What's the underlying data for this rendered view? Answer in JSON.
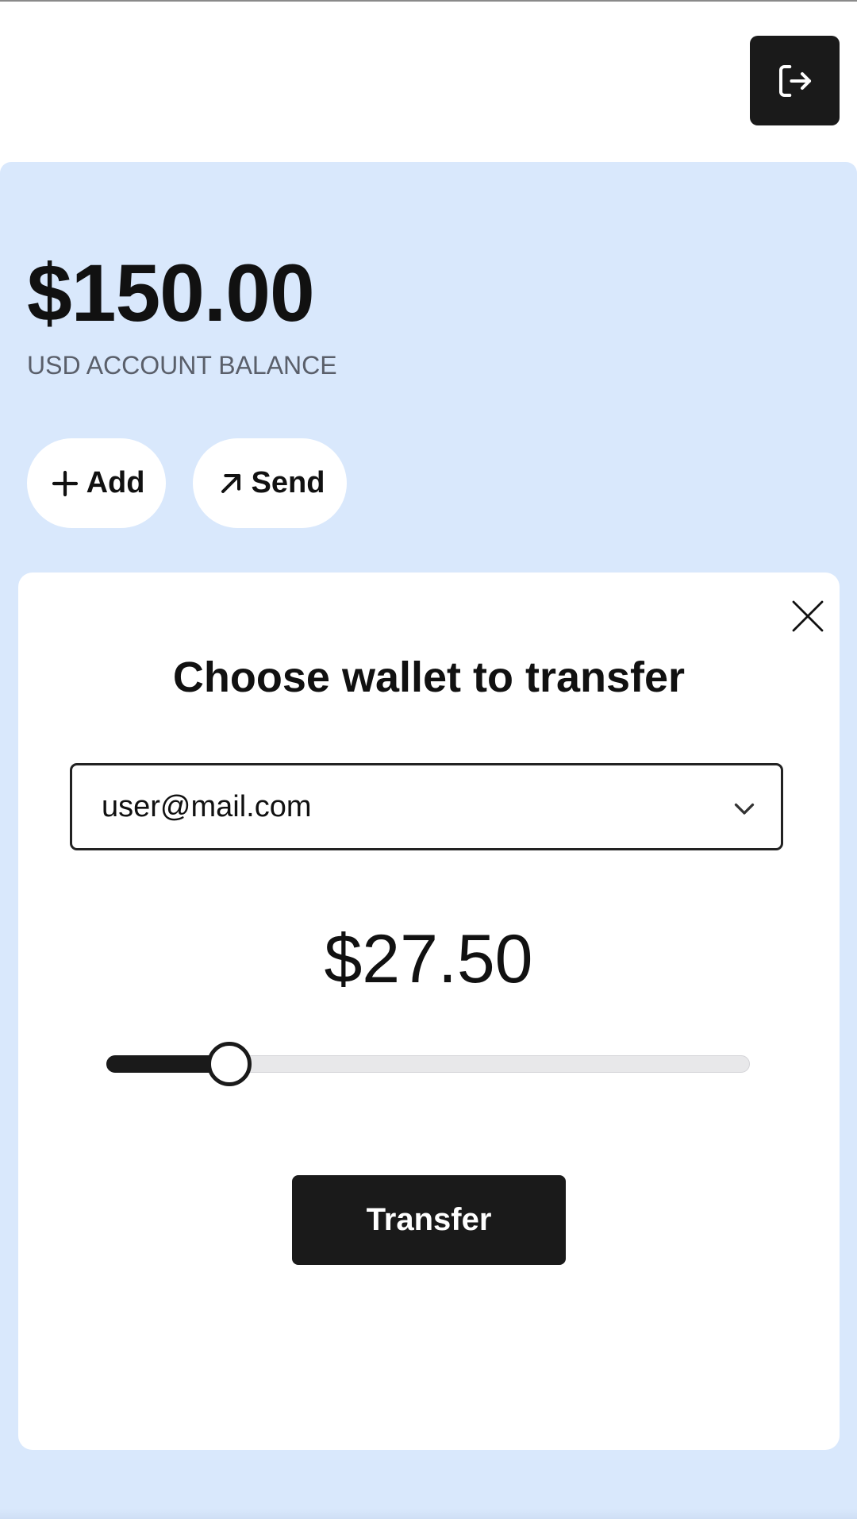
{
  "header": {
    "logout_icon": "logout-icon",
    "colors": {
      "button_bg": "#1a1a1a",
      "icon": "#ffffff"
    }
  },
  "balance": {
    "amount": "$150.00",
    "label": "USD ACCOUNT BALANCE"
  },
  "actions": {
    "add_label": "Add",
    "add_icon": "plus-icon",
    "send_label": "Send",
    "send_icon": "arrow-up-right-icon"
  },
  "modal": {
    "title": "Choose wallet to transfer",
    "close_icon": "close-icon",
    "wallet_select": {
      "selected": "user@mail.com",
      "icon": "chevron-down-icon"
    },
    "amount": "$27.50",
    "slider": {
      "value": 27.5,
      "min": 0,
      "max": 150
    },
    "transfer_label": "Transfer"
  },
  "colors": {
    "panel_bg": "#d9e8fc",
    "primary_dark": "#1a1a1a",
    "muted_text": "#5a5f6a",
    "track": "#e8e8ea"
  }
}
